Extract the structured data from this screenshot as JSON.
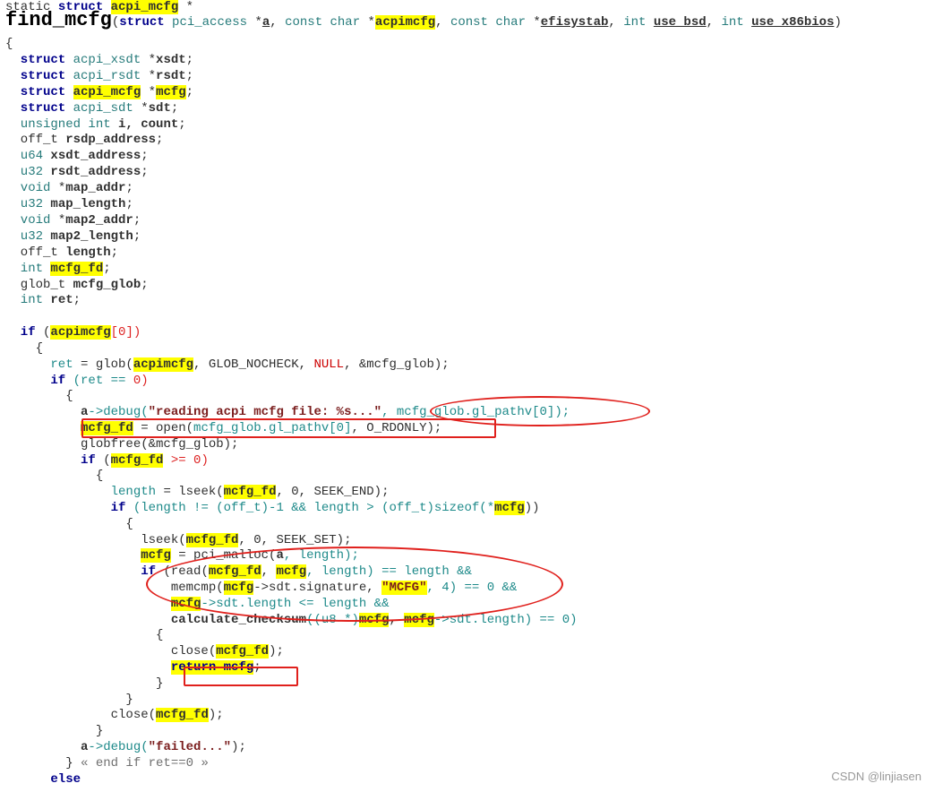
{
  "lines": [
    {
      "tokens": [
        {
          "t": "static ",
          "c": "pl"
        },
        {
          "t": "struct ",
          "c": "kw"
        },
        {
          "t": "acpi_mcfg",
          "c": "hl b"
        },
        {
          "t": " *",
          "c": "pl"
        }
      ]
    },
    {
      "tokens": [
        {
          "t": "find_mcfg",
          "c": "fn"
        },
        {
          "t": "(",
          "c": "pl"
        },
        {
          "t": "struct ",
          "c": "kw"
        },
        {
          "t": "pci_access ",
          "c": "ty"
        },
        {
          "t": "*",
          "c": "pl"
        },
        {
          "t": "a",
          "c": "b u"
        },
        {
          "t": ", ",
          "c": "pl"
        },
        {
          "t": "const char ",
          "c": "ty"
        },
        {
          "t": "*",
          "c": "pl"
        },
        {
          "t": "acpimcfg",
          "c": "hl b"
        },
        {
          "t": ", ",
          "c": "pl"
        },
        {
          "t": "const char ",
          "c": "ty"
        },
        {
          "t": "*",
          "c": "pl"
        },
        {
          "t": "efisystab",
          "c": "b u"
        },
        {
          "t": ", ",
          "c": "pl"
        },
        {
          "t": "int ",
          "c": "ty"
        },
        {
          "t": "use_bsd",
          "c": "b u"
        },
        {
          "t": ", ",
          "c": "pl"
        },
        {
          "t": "int ",
          "c": "ty"
        },
        {
          "t": "use_x86bios",
          "c": "b u"
        },
        {
          "t": ")",
          "c": "pl"
        }
      ]
    },
    {
      "tokens": [
        {
          "t": "{",
          "c": "pl"
        }
      ]
    },
    {
      "tokens": [
        {
          "t": "  struct ",
          "c": "kw"
        },
        {
          "t": "acpi_xsdt ",
          "c": "ty"
        },
        {
          "t": "*",
          "c": "pl"
        },
        {
          "t": "xsdt",
          "c": "b"
        },
        {
          "t": ";",
          "c": "pl"
        }
      ]
    },
    {
      "tokens": [
        {
          "t": "  struct ",
          "c": "kw"
        },
        {
          "t": "acpi_rsdt ",
          "c": "ty"
        },
        {
          "t": "*",
          "c": "pl"
        },
        {
          "t": "rsdt",
          "c": "b"
        },
        {
          "t": ";",
          "c": "pl"
        }
      ]
    },
    {
      "tokens": [
        {
          "t": "  struct ",
          "c": "kw"
        },
        {
          "t": "acpi_mcfg",
          "c": "hl b"
        },
        {
          "t": " *",
          "c": "pl"
        },
        {
          "t": "mcfg",
          "c": "hl b"
        },
        {
          "t": ";",
          "c": "pl"
        }
      ]
    },
    {
      "tokens": [
        {
          "t": "  struct ",
          "c": "kw"
        },
        {
          "t": "acpi_sdt ",
          "c": "ty"
        },
        {
          "t": "*",
          "c": "pl"
        },
        {
          "t": "sdt",
          "c": "b"
        },
        {
          "t": ";",
          "c": "pl"
        }
      ]
    },
    {
      "tokens": [
        {
          "t": "  unsigned int ",
          "c": "ty"
        },
        {
          "t": "i, count",
          "c": "b"
        },
        {
          "t": ";",
          "c": "pl"
        }
      ]
    },
    {
      "tokens": [
        {
          "t": "  off_t ",
          "c": "pl"
        },
        {
          "t": "rsdp_address",
          "c": "b"
        },
        {
          "t": ";",
          "c": "pl"
        }
      ]
    },
    {
      "tokens": [
        {
          "t": "  u64 ",
          "c": "ty"
        },
        {
          "t": "xsdt_address",
          "c": "b"
        },
        {
          "t": ";",
          "c": "pl"
        }
      ]
    },
    {
      "tokens": [
        {
          "t": "  u32 ",
          "c": "ty"
        },
        {
          "t": "rsdt_address",
          "c": "b"
        },
        {
          "t": ";",
          "c": "pl"
        }
      ]
    },
    {
      "tokens": [
        {
          "t": "  void ",
          "c": "ty"
        },
        {
          "t": "*",
          "c": "pl"
        },
        {
          "t": "map_addr",
          "c": "b"
        },
        {
          "t": ";",
          "c": "pl"
        }
      ]
    },
    {
      "tokens": [
        {
          "t": "  u32 ",
          "c": "ty"
        },
        {
          "t": "map_length",
          "c": "b"
        },
        {
          "t": ";",
          "c": "pl"
        }
      ]
    },
    {
      "tokens": [
        {
          "t": "  void ",
          "c": "ty"
        },
        {
          "t": "*",
          "c": "pl"
        },
        {
          "t": "map2_addr",
          "c": "b"
        },
        {
          "t": ";",
          "c": "pl"
        }
      ]
    },
    {
      "tokens": [
        {
          "t": "  u32 ",
          "c": "ty"
        },
        {
          "t": "map2_length",
          "c": "b"
        },
        {
          "t": ";",
          "c": "pl"
        }
      ]
    },
    {
      "tokens": [
        {
          "t": "  off_t ",
          "c": "pl"
        },
        {
          "t": "length",
          "c": "b"
        },
        {
          "t": ";",
          "c": "pl"
        }
      ]
    },
    {
      "tokens": [
        {
          "t": "  int ",
          "c": "ty"
        },
        {
          "t": "mcfg_fd",
          "c": "hl b"
        },
        {
          "t": ";",
          "c": "pl"
        }
      ]
    },
    {
      "tokens": [
        {
          "t": "  glob_t ",
          "c": "pl"
        },
        {
          "t": "mcfg_glob",
          "c": "b"
        },
        {
          "t": ";",
          "c": "pl"
        }
      ]
    },
    {
      "tokens": [
        {
          "t": "  int ",
          "c": "ty"
        },
        {
          "t": "ret",
          "c": "b"
        },
        {
          "t": ";",
          "c": "pl"
        }
      ]
    },
    {
      "tokens": [
        {
          "t": "",
          "c": "pl"
        }
      ]
    },
    {
      "tokens": [
        {
          "t": "  if ",
          "c": "kw"
        },
        {
          "t": "(",
          "c": "pl"
        },
        {
          "t": "acpimcfg",
          "c": "hl b"
        },
        {
          "t": "[0])",
          "c": "num"
        }
      ]
    },
    {
      "tokens": [
        {
          "t": "    {",
          "c": "pl"
        }
      ]
    },
    {
      "tokens": [
        {
          "t": "      ret ",
          "c": "var"
        },
        {
          "t": "= glob(",
          "c": "pl"
        },
        {
          "t": "acpimcfg",
          "c": "hl b"
        },
        {
          "t": ", GLOB_NOCHECK, ",
          "c": "pl"
        },
        {
          "t": "NULL",
          "c": "mac"
        },
        {
          "t": ", &mcfg_glob);",
          "c": "pl"
        }
      ]
    },
    {
      "tokens": [
        {
          "t": "      if ",
          "c": "kw"
        },
        {
          "t": "(ret == ",
          "c": "var"
        },
        {
          "t": "0)",
          "c": "num"
        }
      ]
    },
    {
      "tokens": [
        {
          "t": "        {",
          "c": "pl"
        }
      ]
    },
    {
      "tokens": [
        {
          "t": "          a",
          "c": "b"
        },
        {
          "t": "->debug(",
          "c": "var"
        },
        {
          "t": "\"reading acpi mcfg file: %s...\"",
          "c": "st"
        },
        {
          "t": ", mcfg_glob.gl_pathv[0]);",
          "c": "var"
        }
      ]
    },
    {
      "tokens": [
        {
          "t": "          ",
          "c": "pl"
        },
        {
          "t": "mcfg_fd",
          "c": "hl b"
        },
        {
          "t": " = open(",
          "c": "pl"
        },
        {
          "t": "mcfg_glob.gl_pathv[0]",
          "c": "var"
        },
        {
          "t": ", O_RDONLY);",
          "c": "pl"
        }
      ]
    },
    {
      "tokens": [
        {
          "t": "          globfree(&mcfg_glob);",
          "c": "pl"
        }
      ]
    },
    {
      "tokens": [
        {
          "t": "          if ",
          "c": "kw"
        },
        {
          "t": "(",
          "c": "pl"
        },
        {
          "t": "mcfg_fd",
          "c": "hl b"
        },
        {
          "t": " >= 0)",
          "c": "num"
        }
      ]
    },
    {
      "tokens": [
        {
          "t": "            {",
          "c": "pl"
        }
      ]
    },
    {
      "tokens": [
        {
          "t": "              length ",
          "c": "var"
        },
        {
          "t": "= lseek(",
          "c": "pl"
        },
        {
          "t": "mcfg_fd",
          "c": "hl b"
        },
        {
          "t": ", 0, SEEK_END);",
          "c": "pl"
        }
      ]
    },
    {
      "tokens": [
        {
          "t": "              if ",
          "c": "kw"
        },
        {
          "t": "(length != (off_t)-1 && length > (off_t)sizeof(*",
          "c": "var"
        },
        {
          "t": "mcfg",
          "c": "hl b"
        },
        {
          "t": "))",
          "c": "pl"
        }
      ]
    },
    {
      "tokens": [
        {
          "t": "                {",
          "c": "pl"
        }
      ]
    },
    {
      "tokens": [
        {
          "t": "                  lseek(",
          "c": "pl"
        },
        {
          "t": "mcfg_fd",
          "c": "hl b"
        },
        {
          "t": ", 0, SEEK_SET);",
          "c": "pl"
        }
      ]
    },
    {
      "tokens": [
        {
          "t": "                  ",
          "c": "pl"
        },
        {
          "t": "mcfg",
          "c": "hl b"
        },
        {
          "t": " = pci_malloc(",
          "c": "pl"
        },
        {
          "t": "a",
          "c": "b"
        },
        {
          "t": ", length);",
          "c": "var"
        }
      ]
    },
    {
      "tokens": [
        {
          "t": "                  if ",
          "c": "kw"
        },
        {
          "t": "(read(",
          "c": "pl"
        },
        {
          "t": "mcfg_fd",
          "c": "hl b"
        },
        {
          "t": ", ",
          "c": "pl"
        },
        {
          "t": "mcfg",
          "c": "hl b"
        },
        {
          "t": ", length) == length &&",
          "c": "var"
        }
      ]
    },
    {
      "tokens": [
        {
          "t": "                      memcmp(",
          "c": "pl"
        },
        {
          "t": "mcfg",
          "c": "hl b"
        },
        {
          "t": "->sdt.signature, ",
          "c": "pl"
        },
        {
          "t": "\"MCFG\"",
          "c": "hl st"
        },
        {
          "t": ", 4) == 0 &&",
          "c": "var"
        }
      ]
    },
    {
      "tokens": [
        {
          "t": "                      ",
          "c": "pl"
        },
        {
          "t": "mcfg",
          "c": "hl b"
        },
        {
          "t": "->sdt.length <= length &&",
          "c": "var"
        }
      ]
    },
    {
      "tokens": [
        {
          "t": "                      calculate_checksum",
          "c": "b"
        },
        {
          "t": "((u8 *)",
          "c": "var"
        },
        {
          "t": "mcfg",
          "c": "hl b"
        },
        {
          "t": ", ",
          "c": "pl"
        },
        {
          "t": "mcfg",
          "c": "hl b"
        },
        {
          "t": "->sdt.length) == 0)",
          "c": "var"
        }
      ]
    },
    {
      "tokens": [
        {
          "t": "                    {",
          "c": "pl"
        }
      ]
    },
    {
      "tokens": [
        {
          "t": "                      close(",
          "c": "pl"
        },
        {
          "t": "mcfg_fd",
          "c": "hl b"
        },
        {
          "t": ");",
          "c": "pl"
        }
      ]
    },
    {
      "tokens": [
        {
          "t": "                      ",
          "c": "pl"
        },
        {
          "t": "return mcfg",
          "c": "hl kw"
        },
        {
          "t": ";",
          "c": "pl"
        }
      ]
    },
    {
      "tokens": [
        {
          "t": "                    }",
          "c": "pl"
        }
      ]
    },
    {
      "tokens": [
        {
          "t": "                }",
          "c": "pl"
        }
      ]
    },
    {
      "tokens": [
        {
          "t": "              close(",
          "c": "pl"
        },
        {
          "t": "mcfg_fd",
          "c": "hl b"
        },
        {
          "t": ");",
          "c": "pl"
        }
      ]
    },
    {
      "tokens": [
        {
          "t": "            }",
          "c": "pl"
        }
      ]
    },
    {
      "tokens": [
        {
          "t": "          a",
          "c": "b"
        },
        {
          "t": "->debug(",
          "c": "var"
        },
        {
          "t": "\"failed...\"",
          "c": "st"
        },
        {
          "t": ");",
          "c": "pl"
        }
      ]
    },
    {
      "tokens": [
        {
          "t": "        } ",
          "c": "pl"
        },
        {
          "t": "« end if ret==0 »",
          "c": "fold"
        }
      ]
    },
    {
      "tokens": [
        {
          "t": "      else",
          "c": "kw"
        }
      ]
    }
  ],
  "watermark": "CSDN @linjiasen"
}
